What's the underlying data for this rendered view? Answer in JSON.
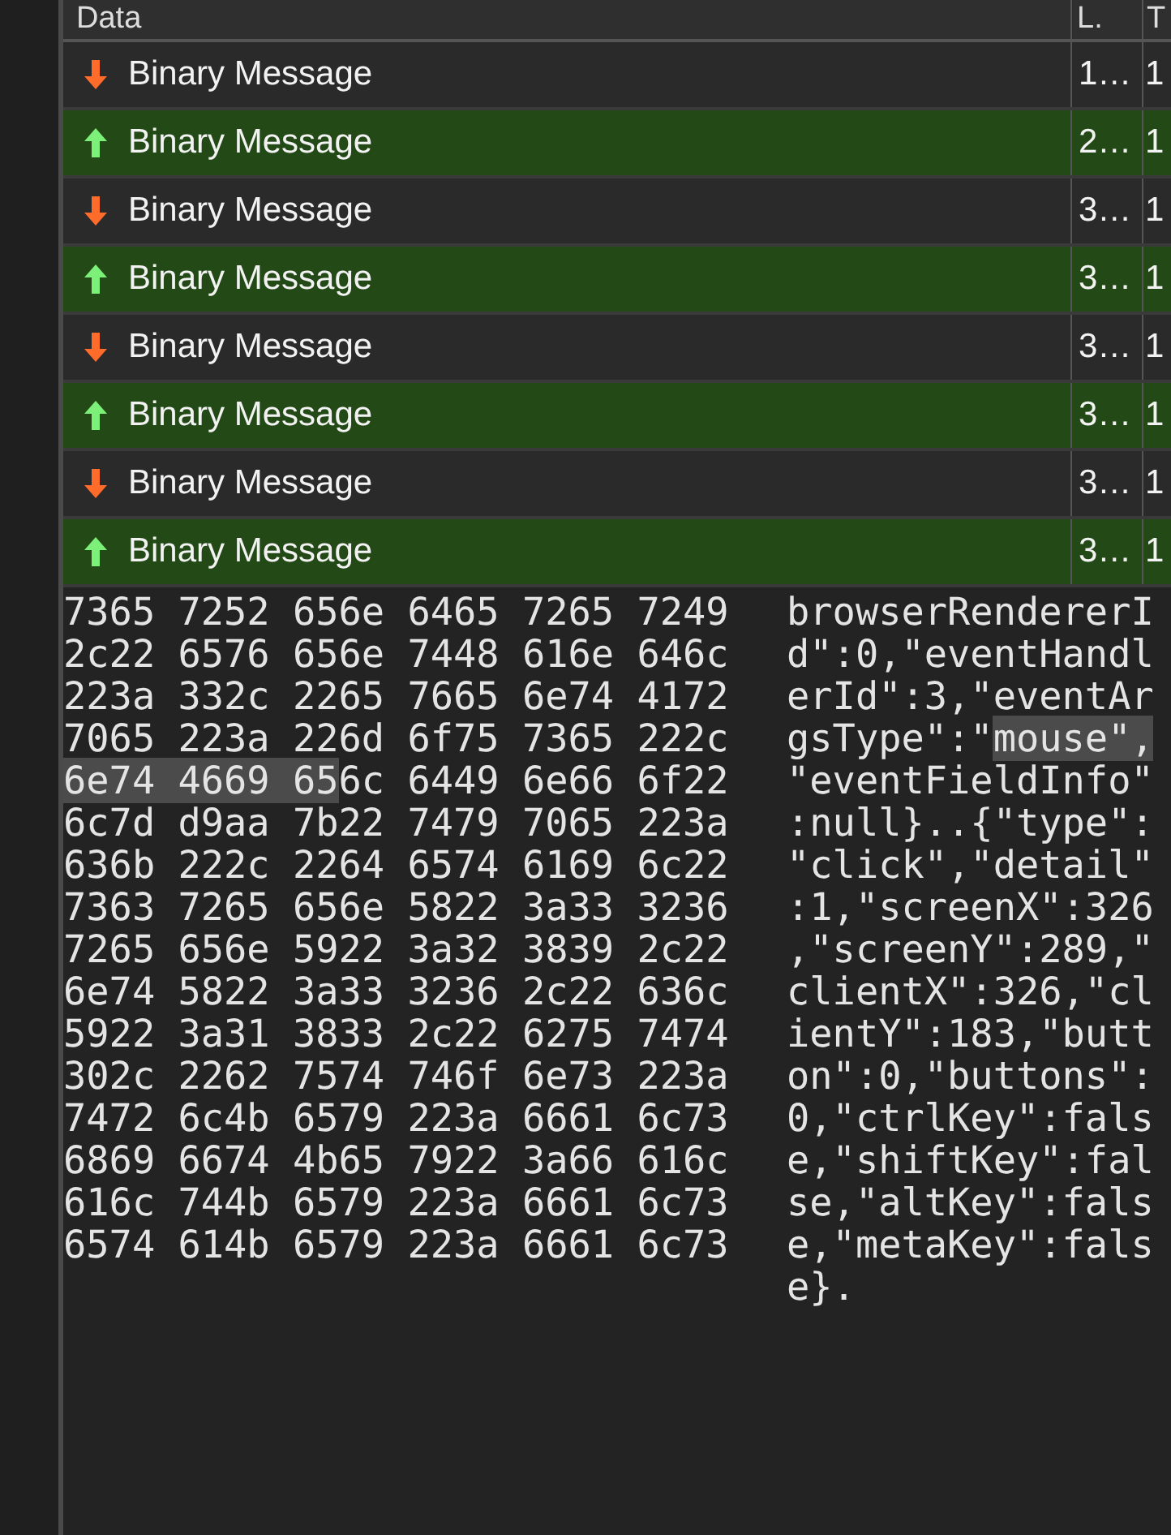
{
  "table": {
    "columns": [
      {
        "label": "Data"
      },
      {
        "label": "L."
      },
      {
        "label": "T"
      }
    ],
    "rows": [
      {
        "kind": "received",
        "data": "Binary Message",
        "length": "1…",
        "column_3": "1"
      },
      {
        "kind": "sent",
        "data": "Binary Message",
        "length": "2…",
        "column_3": "1"
      },
      {
        "kind": "received",
        "data": "Binary Message",
        "length": "3…",
        "column_3": "1"
      },
      {
        "kind": "sent",
        "data": "Binary Message",
        "length": "3…",
        "column_3": "1"
      },
      {
        "kind": "received",
        "data": "Binary Message",
        "length": "3…",
        "column_3": "1"
      },
      {
        "kind": "sent",
        "data": "Binary Message",
        "length": "3…",
        "column_3": "1"
      },
      {
        "kind": "received",
        "data": "Binary Message",
        "length": "3…",
        "column_3": "1"
      },
      {
        "kind": "sent",
        "data": "Binary Message",
        "length": "3…",
        "column_3": "1"
      }
    ]
  },
  "hex_dump": {
    "hex_lines": [
      [
        {
          "text": "7365 7252 656e 6465 7265 7249",
          "selected": false
        }
      ],
      [
        {
          "text": "2c22 6576 656e 7448 616e 646c",
          "selected": false
        }
      ],
      [
        {
          "text": "223a 332c 2265 7665 6e74 4172",
          "selected": false
        }
      ],
      [
        {
          "text": "7065 223a 226d 6f75 7365 222c",
          "selected": false
        }
      ],
      [
        {
          "text": "6e74 4669 65",
          "selected": true
        },
        {
          "text": "6c 6449 6e66 6f22",
          "selected": false
        }
      ],
      [
        {
          "text": "6c7d d9aa 7b22 7479 7065 223a",
          "selected": false
        }
      ],
      [
        {
          "text": "636b 222c 2264 6574 6169 6c22",
          "selected": false
        }
      ],
      [
        {
          "text": "7363 7265 656e 5822 3a33 3236",
          "selected": false
        }
      ],
      [
        {
          "text": "7265 656e 5922 3a32 3839 2c22",
          "selected": false
        }
      ],
      [
        {
          "text": "6e74 5822 3a33 3236 2c22 636c",
          "selected": false
        }
      ],
      [
        {
          "text": "5922 3a31 3833 2c22 6275 7474",
          "selected": false
        }
      ],
      [
        {
          "text": "302c 2262 7574 746f 6e73 223a",
          "selected": false
        }
      ],
      [
        {
          "text": "7472 6c4b 6579 223a 6661 6c73",
          "selected": false
        }
      ],
      [
        {
          "text": "6869 6674 4b65 7922 3a66 616c",
          "selected": false
        }
      ],
      [
        {
          "text": "616c 744b 6579 223a 6661 6c73",
          "selected": false
        }
      ],
      [
        {
          "text": "6574 614b 6579 223a 6661 6c73",
          "selected": false
        }
      ]
    ],
    "text_lines": [
      [
        {
          "text": "browserRendererI",
          "selected": false
        }
      ],
      [
        {
          "text": "d\":0,\"eventHandl",
          "selected": false
        }
      ],
      [
        {
          "text": "erId\":3,\"eventAr",
          "selected": false
        }
      ],
      [
        {
          "text": "gsType\":\"",
          "selected": false
        },
        {
          "text": "mouse\",",
          "selected": true
        }
      ],
      [
        {
          "text": "\"eventFieldInfo\"",
          "selected": false
        }
      ],
      [
        {
          "text": ":null}..{\"type\":",
          "selected": false
        }
      ],
      [
        {
          "text": "\"click\",\"detail\"",
          "selected": false
        }
      ],
      [
        {
          "text": ":1,\"screenX\":326",
          "selected": false
        }
      ],
      [
        {
          "text": ",\"screenY\":289,\"",
          "selected": false
        }
      ],
      [
        {
          "text": "clientX\":326,\"cl",
          "selected": false
        }
      ],
      [
        {
          "text": "ientY\":183,\"butt",
          "selected": false
        }
      ],
      [
        {
          "text": "on\":0,\"buttons\":",
          "selected": false
        }
      ],
      [
        {
          "text": "0,\"ctrlKey\":fals",
          "selected": false
        }
      ],
      [
        {
          "text": "e,\"shiftKey\":fal",
          "selected": false
        }
      ],
      [
        {
          "text": "se,\"altKey\":fals",
          "selected": false
        }
      ],
      [
        {
          "text": "e,\"metaKey\":fals",
          "selected": false
        }
      ],
      [
        {
          "text": "e}.",
          "selected": false
        }
      ]
    ]
  }
}
